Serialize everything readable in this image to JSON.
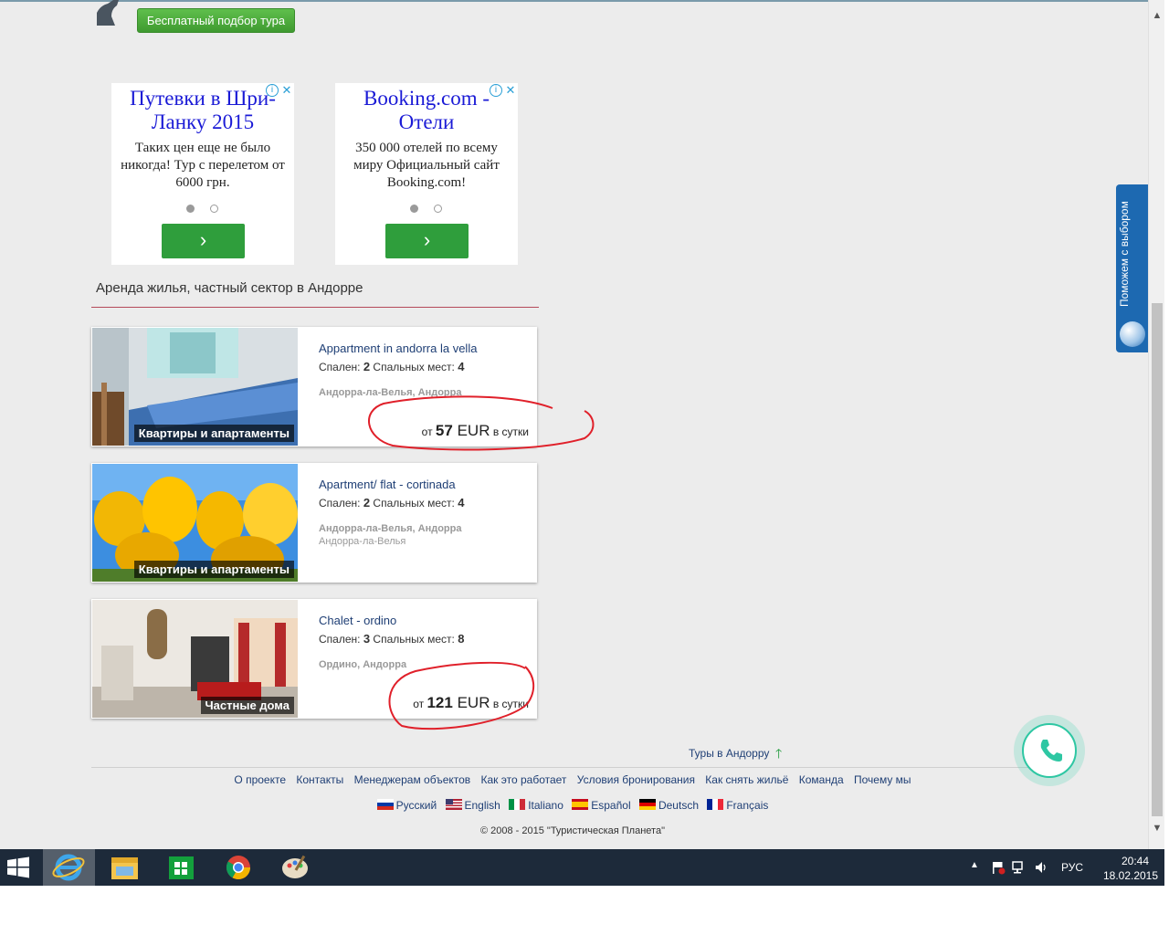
{
  "top": {
    "free_button": "Бесплатный подбор тура"
  },
  "ads": [
    {
      "title": "Путевки в Шри-Ланку 2015",
      "text": "Таких цен еще не было никогда! Тур с перелетом от 6000 грн.",
      "button": "›"
    },
    {
      "title": "Booking.com - Отели",
      "text": "350 000 отелей по всему миру Официальный сайт Booking.com!",
      "button": "›"
    }
  ],
  "section": {
    "title": "Аренда жилья, частный сектор в Андорре"
  },
  "listings": [
    {
      "badge": "Квартиры и апартаменты",
      "title": "Appartment in andorra la vella",
      "bedrooms_label": "Спален:",
      "bedrooms": "2",
      "beds_label": "Спальных мест:",
      "beds": "4",
      "location": "Андорра-ла-Велья, Андорра",
      "sublocation": "",
      "price_from": "от",
      "price_amount": "57",
      "price_currency": "EUR",
      "price_unit": "в сутки"
    },
    {
      "badge": "Квартиры и апартаменты",
      "title": "Apartment/ flat - cortinada",
      "bedrooms_label": "Спален:",
      "bedrooms": "2",
      "beds_label": "Спальных мест:",
      "beds": "4",
      "location": "Андорра-ла-Велья, Андорра",
      "sublocation": "Андорра-ла-Велья",
      "price_from": "",
      "price_amount": "",
      "price_currency": "",
      "price_unit": ""
    },
    {
      "badge": "Частные дома",
      "title": "Chalet - ordino",
      "bedrooms_label": "Спален:",
      "bedrooms": "3",
      "beds_label": "Спальных мест:",
      "beds": "8",
      "location": "Ордино, Андорра",
      "sublocation": "",
      "price_from": "от",
      "price_amount": "121",
      "price_currency": "EUR",
      "price_unit": "в сутки"
    }
  ],
  "footer": {
    "tours_link": "Туры в Андорру",
    "links": [
      "О проекте",
      "Контакты",
      "Менеджерам объектов",
      "Как это работает",
      "Условия бронирования",
      "Как снять жильё",
      "Команда",
      "Почему мы"
    ],
    "languages": [
      "Русский",
      "English",
      "Italiano",
      "Español",
      "Deutsch",
      "Français"
    ],
    "copyright": "© 2008 - 2015 \"Туристическая Планета\""
  },
  "side_tab": {
    "label": "Поможем с выбором"
  },
  "taskbar": {
    "lang": "РУС",
    "time": "20:44",
    "date": "18.02.2015"
  },
  "colors": {
    "accent_green": "#3f9a30",
    "link_blue": "#1f3f75",
    "side_tab_blue": "#1d69b1",
    "annotation_red": "#e0202a"
  }
}
